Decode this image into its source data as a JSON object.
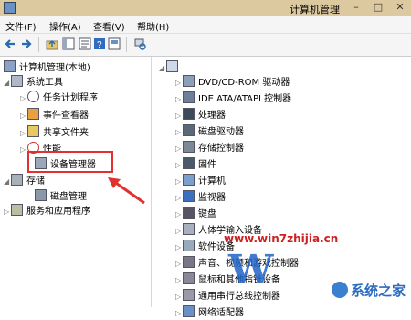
{
  "window": {
    "title": "计算机管理"
  },
  "menu": {
    "file": "文件(F)",
    "action": "操作(A)",
    "view": "查看(V)",
    "help": "帮助(H)"
  },
  "left_tree": {
    "root": "计算机管理(本地)",
    "system_tools": "系统工具",
    "task_scheduler": "任务计划程序",
    "event_viewer": "事件查看器",
    "shared_folders": "共享文件夹",
    "performance": "性能",
    "device_manager": "设备管理器",
    "storage": "存储",
    "disk_management": "磁盘管理",
    "services_apps": "服务和应用程序"
  },
  "right_tree": {
    "items": [
      "DVD/CD-ROM 驱动器",
      "IDE ATA/ATAPI 控制器",
      "处理器",
      "磁盘驱动器",
      "存储控制器",
      "固件",
      "计算机",
      "监视器",
      "键盘",
      "人体学输入设备",
      "软件设备",
      "声音、视频和游戏控制器",
      "鼠标和其他指针设备",
      "通用串行总线控制器",
      "网络适配器"
    ]
  },
  "watermark": {
    "site": "www.win7zhijia.cn",
    "brand": "系统之家",
    "letter": "W"
  },
  "colors": {
    "highlight": "#e03030",
    "titlebar": "#dcc9a0"
  }
}
